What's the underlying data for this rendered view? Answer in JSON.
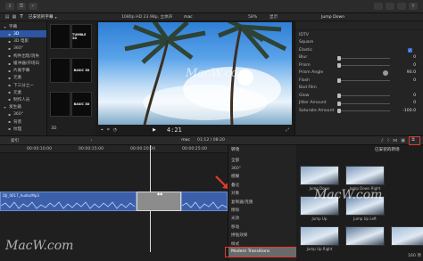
{
  "topbar": {
    "library_label": "已安装的字幕",
    "video_format": "1080p HD 23.98p, 立体声",
    "project_name": "mac",
    "zoom": "58%",
    "view_label": "显示",
    "inspector_title": "Jump Down"
  },
  "sidebar": {
    "items": [
      {
        "label": "字幕",
        "level": 0
      },
      {
        "label": "3D",
        "level": 1
      },
      {
        "label": "3D 电影",
        "level": 1
      },
      {
        "label": "360°",
        "level": 1
      },
      {
        "label": "构件出现/消失",
        "level": 1
      },
      {
        "label": "缓冲器/开场白",
        "level": 1
      },
      {
        "label": "片尾字幕",
        "level": 1
      },
      {
        "label": "元素",
        "level": 1
      },
      {
        "label": "下三分之一",
        "level": 1
      },
      {
        "label": "元素",
        "level": 1
      },
      {
        "label": "制作人员",
        "level": 1
      },
      {
        "label": "发生器",
        "level": 0
      },
      {
        "label": "360°",
        "level": 1
      },
      {
        "label": "背景",
        "level": 1
      },
      {
        "label": "纹理",
        "level": 1
      }
    ],
    "selected_index": 1
  },
  "browser_tiles": [
    {
      "label": "",
      "thumb": "",
      "row": 0,
      "col": 0
    },
    {
      "label": "",
      "thumb": "TUMBLE 3D",
      "row": 0,
      "col": 1
    },
    {
      "label": "",
      "thumb": "",
      "row": 1,
      "col": 0
    },
    {
      "label": "",
      "thumb": "BASIC 3D",
      "row": 1,
      "col": 1
    },
    {
      "label": "",
      "thumb": "",
      "row": 2,
      "col": 0
    },
    {
      "label": "",
      "thumb": "BASIC 3D",
      "row": 2,
      "col": 1
    }
  ],
  "browser_bottom_label": "3D",
  "viewer": {
    "timecode": "4:21",
    "watermark": "MacW.com"
  },
  "inspector": {
    "rows": [
      {
        "label": "IDTV",
        "type": "text"
      },
      {
        "label": "Square",
        "type": "text"
      },
      {
        "label": "Elastic",
        "type": "check"
      },
      {
        "label": "Blur",
        "type": "slider",
        "value": "0"
      },
      {
        "label": "Prism",
        "type": "slider",
        "value": "0"
      },
      {
        "label": "Prism Angle",
        "type": "dial",
        "value": "90.0"
      },
      {
        "label": "Flash",
        "type": "slider",
        "value": "0"
      },
      {
        "label": "Bad Film",
        "type": "text"
      },
      {
        "label": "Glow",
        "type": "slider",
        "value": "0"
      },
      {
        "label": "Jitter Amount",
        "type": "slider",
        "value": "0"
      },
      {
        "label": "Saturate Amount",
        "type": "slider",
        "value": "-100.0"
      }
    ]
  },
  "timeline_bar": {
    "index_label": "索引",
    "project": "mac",
    "position": "01:12 / 08:20"
  },
  "ruler_marks": [
    "00:00:10:00",
    "00:00:15:00",
    "00:00:20:00",
    "00:00:25:00"
  ],
  "clip": {
    "label": "DJI_0017_Audio/Mp3"
  },
  "categories": {
    "header": "转场",
    "items": [
      "全部",
      "360°",
      "模糊",
      "叠化",
      "对象",
      "复制器/克隆",
      "擦除",
      "光效",
      "移动",
      "拼贴效果",
      "样式",
      "Modern Transitions"
    ],
    "selected": "Modern Transitions"
  },
  "transitions": {
    "header": "已安装的转场",
    "items": [
      {
        "label": "Jump Down"
      },
      {
        "label": "Jump Down Right"
      },
      {
        "label": "Jump Up"
      },
      {
        "label": "Jump Up Left"
      },
      {
        "label": "Jump Up Right"
      },
      {
        "label": ""
      },
      {
        "label": ""
      }
    ]
  },
  "transitions_count": "160 项",
  "watermark_text": "MacW.com",
  "colors": {
    "selection": "#2d56a3",
    "accent_red": "#e23a2e",
    "clip_blue": "#3b5fa8"
  }
}
